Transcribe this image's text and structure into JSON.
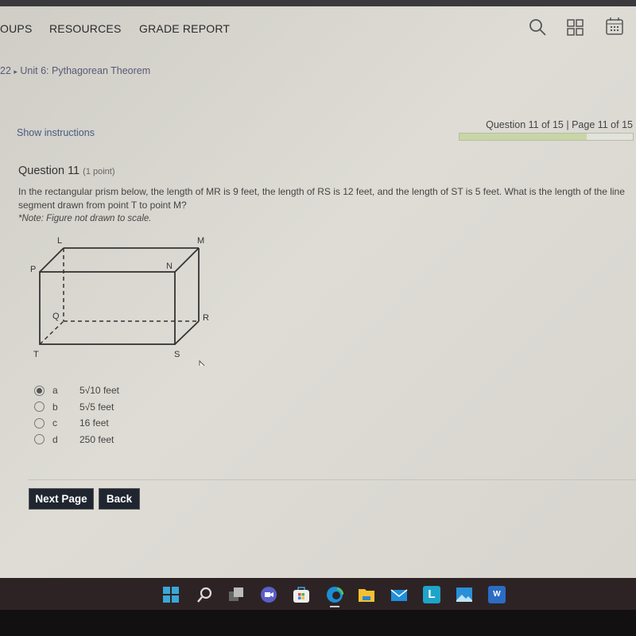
{
  "nav": {
    "items": [
      "OUPS",
      "RESOURCES",
      "GRADE REPORT"
    ]
  },
  "header_icons": [
    "search-icon",
    "apps-grid-icon",
    "calendar-icon"
  ],
  "breadcrumb": {
    "prefix": "22",
    "current": "Unit 6: Pythagorean Theorem"
  },
  "show_instructions": "Show instructions",
  "progress": {
    "label": "Question 11 of 15 | Page 11 of 15",
    "fraction": 0.733
  },
  "question": {
    "title": "Question 11",
    "points": "(1 point)",
    "text": "In the rectangular prism below, the length of MR is 9 feet, the length of RS is 12 feet, and the length of ST is 5 feet. What is the length of the line segment drawn from point T to point M?",
    "note": "*Note: Figure not drawn to scale.",
    "figure_labels": {
      "L": "L",
      "M": "M",
      "P": "P",
      "N": "N",
      "Q": "Q",
      "R": "R",
      "T": "T",
      "S": "S"
    },
    "options": [
      {
        "letter": "a",
        "text": "5√10 feet",
        "selected": true
      },
      {
        "letter": "b",
        "text": "5√5 feet",
        "selected": false
      },
      {
        "letter": "c",
        "text": "16 feet",
        "selected": false
      },
      {
        "letter": "d",
        "text": "250 feet",
        "selected": false
      }
    ]
  },
  "buttons": {
    "next": "Next Page",
    "back": "Back"
  },
  "taskbar": {
    "icons": [
      "start-icon",
      "search-icon",
      "task-view-icon",
      "teams-icon",
      "store-icon",
      "edge-icon",
      "file-explorer-icon",
      "mail-icon",
      "l-app-icon",
      "photos-icon",
      "word-icon"
    ],
    "word_letter": "W",
    "l_letter": "L"
  }
}
